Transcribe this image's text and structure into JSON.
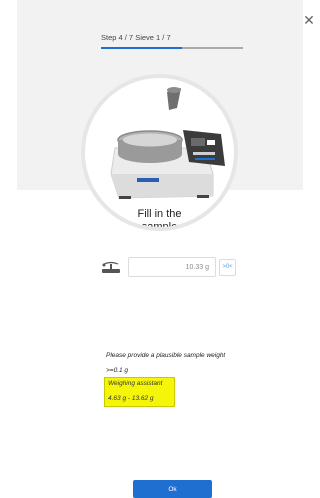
{
  "wizard": {
    "step_label": "Step 4 / 7 Sieve 1 / 7",
    "progress_fraction": 0.57,
    "close_icon": "close-icon",
    "accent_color": "#1f6fd1"
  },
  "instruction": {
    "line1": "Fill in the",
    "line2": "sample"
  },
  "weight": {
    "icon": "scale-icon",
    "value": "10.33 g",
    "tare_label": ">0<"
  },
  "validation": {
    "message": "Please provide a plausible sample weight",
    "minimum": ">=0.1 g"
  },
  "assistant": {
    "title": "Weighing assistant",
    "range": "4.63 g - 13.62 g",
    "highlight_color": "#f5f50a"
  },
  "footer": {
    "ok_label": "Ok"
  }
}
